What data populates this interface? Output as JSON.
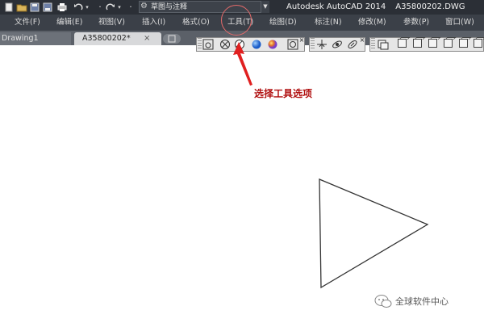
{
  "quick_access": {
    "workspace_label": "草图与注释",
    "icons": [
      "new-file-icon",
      "open-file-icon",
      "save-icon",
      "save-as-icon",
      "print-icon",
      "undo-icon",
      "redo-icon"
    ]
  },
  "title": {
    "app": "Autodesk AutoCAD 2014",
    "file": "A35800202.DWG"
  },
  "menu": {
    "items": [
      "文件(F)",
      "编辑(E)",
      "视图(V)",
      "插入(I)",
      "格式(O)",
      "工具(T)",
      "绘图(D)",
      "标注(N)",
      "修改(M)",
      "参数(P)",
      "窗口(W)"
    ]
  },
  "tabs": {
    "items": [
      "Drawing1",
      "A35800202*"
    ],
    "close": "×"
  },
  "annotation": {
    "text": "选择工具选项",
    "color": "#b01010"
  },
  "watermark": {
    "text": "全球软件中心"
  },
  "colors": {
    "titlebar": "#2b2f36",
    "menubar": "#3b4048",
    "tabbar": "#5b6068",
    "canvas": "#ffffff",
    "arrow": "#e02020"
  }
}
